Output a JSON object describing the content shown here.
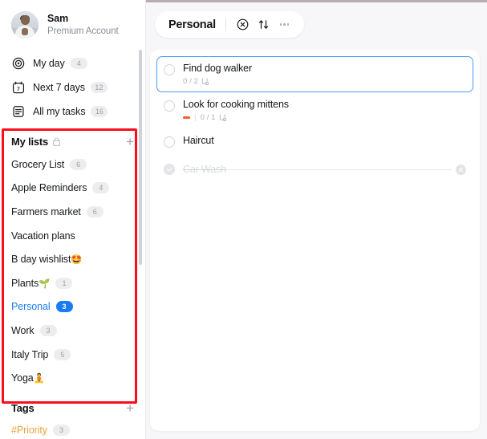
{
  "account": {
    "name": "Sam",
    "subtitle": "Premium Account",
    "avatar_icon": "user-photo-avatar"
  },
  "sidebar": {
    "smart_lists": [
      {
        "label": "My day",
        "count": "4",
        "icon": "target-icon"
      },
      {
        "label": "Next 7 days",
        "count": "12",
        "icon": "calendar-7-icon"
      },
      {
        "label": "All my tasks",
        "count": "16",
        "icon": "document-list-icon"
      }
    ],
    "my_lists": {
      "title": "My lists",
      "lock_icon": "lock-icon",
      "add_icon": "plus-icon",
      "items": [
        {
          "label": "Grocery List",
          "emoji": "",
          "count": "6",
          "active": false
        },
        {
          "label": "Apple Reminders",
          "emoji": "",
          "count": "4",
          "active": false
        },
        {
          "label": "Farmers market",
          "emoji": "",
          "count": "6",
          "active": false
        },
        {
          "label": "Vacation plans",
          "emoji": "",
          "count": "",
          "active": false
        },
        {
          "label": "B day wishlist ",
          "emoji": "🤩",
          "count": "",
          "active": false
        },
        {
          "label": "Plants",
          "emoji": "🌱",
          "count": "1",
          "active": false
        },
        {
          "label": "Personal",
          "emoji": "",
          "count": "3",
          "active": true
        },
        {
          "label": "Work",
          "emoji": "",
          "count": "3",
          "active": false
        },
        {
          "label": "Italy Trip",
          "emoji": "",
          "count": "5",
          "active": false
        },
        {
          "label": "Yoga",
          "emoji": "🧘",
          "count": "",
          "active": false
        }
      ]
    },
    "tags": {
      "title": "Tags",
      "add_icon": "plus-icon",
      "items": [
        {
          "label": "#Priority",
          "count": "3"
        }
      ]
    }
  },
  "main": {
    "header": {
      "title": "Personal",
      "clear_icon": "circle-x-icon",
      "sort_icon": "sort-arrows-icon",
      "more_icon": "ellipsis-icon"
    },
    "tasks": [
      {
        "title": "Find dog walker",
        "selected": true,
        "done": false,
        "priority": false,
        "subtasks": "0 / 2",
        "subtask_icon": "subtask-branch-icon"
      },
      {
        "title": "Look for cooking mittens",
        "selected": false,
        "done": false,
        "priority": true,
        "subtasks": "0 / 1",
        "subtask_icon": "subtask-branch-icon"
      },
      {
        "title": "Haircut",
        "selected": false,
        "done": false,
        "priority": false,
        "subtasks": "",
        "subtask_icon": ""
      },
      {
        "title": "Car Wash",
        "selected": false,
        "done": true,
        "priority": false,
        "subtasks": "",
        "subtask_icon": "",
        "delete_icon": "circle-x-icon"
      }
    ]
  },
  "colors": {
    "accent_blue": "#1a7cf5",
    "priority_orange": "#f4602a",
    "tag_orange": "#e8a33d",
    "annotation_red": "#fc0d1c",
    "panel_bg": "#f7f7f9"
  }
}
